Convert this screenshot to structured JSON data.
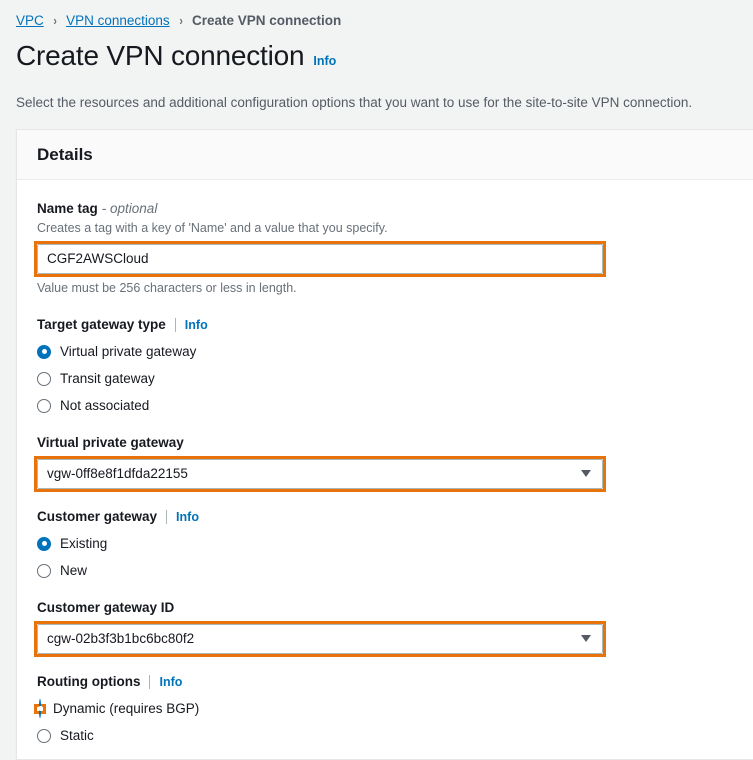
{
  "breadcrumb": {
    "items": [
      {
        "label": "VPC",
        "type": "link"
      },
      {
        "label": "VPN connections",
        "type": "link"
      },
      {
        "label": "Create VPN connection",
        "type": "current"
      }
    ],
    "separator": "›"
  },
  "page": {
    "title": "Create VPN connection",
    "info_label": "Info",
    "description": "Select the resources and additional configuration options that you want to use for the site-to-site VPN connection."
  },
  "details_panel": {
    "header": "Details",
    "name_tag": {
      "label": "Name tag",
      "optional_suffix": "- optional",
      "hint": "Creates a tag with a key of 'Name' and a value that you specify.",
      "value": "CGF2AWSCloud",
      "placeholder": "",
      "constraint": "Value must be 256 characters or less in length.",
      "highlighted": true
    },
    "target_gateway_type": {
      "label": "Target gateway type",
      "info_label": "Info",
      "options": [
        {
          "label": "Virtual private gateway",
          "selected": true
        },
        {
          "label": "Transit gateway",
          "selected": false
        },
        {
          "label": "Not associated",
          "selected": false
        }
      ]
    },
    "virtual_private_gateway": {
      "label": "Virtual private gateway",
      "value": "vgw-0ff8e8f1dfda22155",
      "caret_icon": "chevron-down-icon",
      "highlighted": true
    },
    "customer_gateway": {
      "label": "Customer gateway",
      "info_label": "Info",
      "options": [
        {
          "label": "Existing",
          "selected": true
        },
        {
          "label": "New",
          "selected": false
        }
      ]
    },
    "customer_gateway_id": {
      "label": "Customer gateway ID",
      "value": "cgw-02b3f3b1bc6bc80f2",
      "caret_icon": "chevron-down-icon",
      "highlighted": true
    },
    "routing_options": {
      "label": "Routing options",
      "info_label": "Info",
      "options": [
        {
          "label": "Dynamic (requires BGP)",
          "selected": true,
          "highlighted": true
        },
        {
          "label": "Static",
          "selected": false,
          "highlighted": false
        }
      ]
    }
  },
  "colors": {
    "accent_blue": "#0073bb",
    "highlight_orange": "#e8730b",
    "page_background": "#f2f3f3",
    "text_primary": "#16191f",
    "text_secondary": "#687078"
  }
}
